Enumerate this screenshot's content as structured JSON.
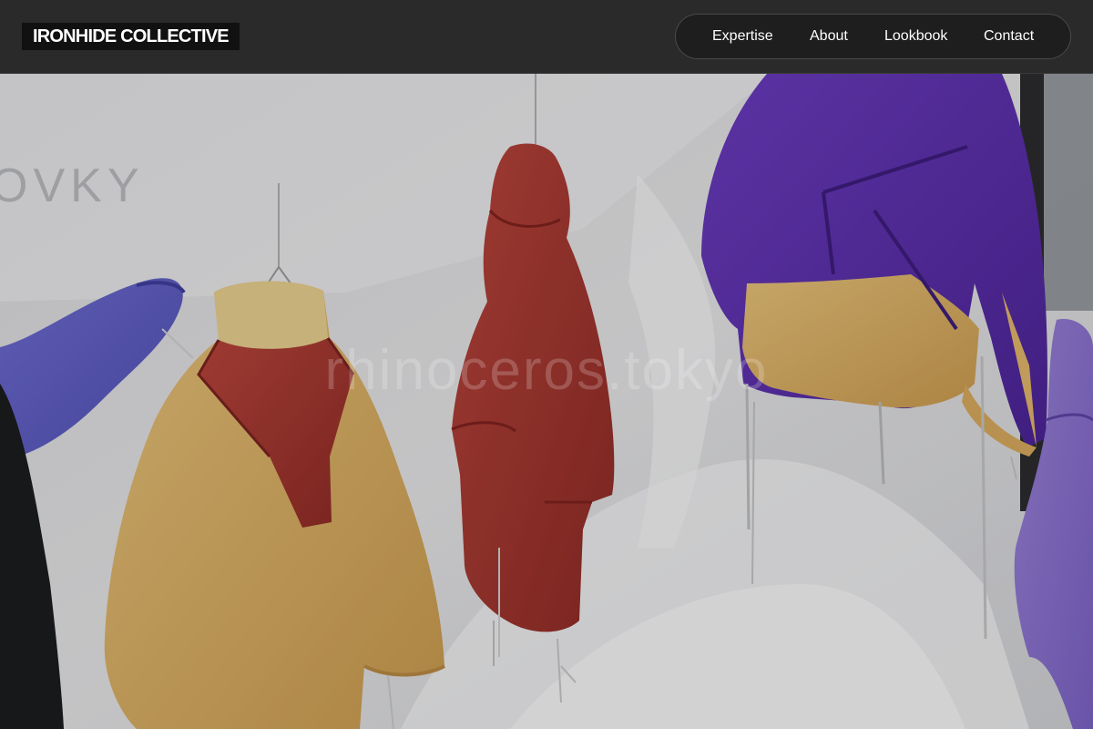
{
  "brand": {
    "name": "IRONHIDE COLLECTIVE"
  },
  "nav": {
    "items": [
      {
        "label": "Expertise"
      },
      {
        "label": "About"
      },
      {
        "label": "Lookbook"
      },
      {
        "label": "Contact"
      }
    ]
  },
  "hero": {
    "watermark": "rhinoceros.tokyo",
    "backdrop_text": "OVKY"
  },
  "colors": {
    "header_bg": "#2a2a2a",
    "logo_bg": "#111111",
    "nav_bg": "#1e1e1e",
    "text": "#ffffff"
  }
}
